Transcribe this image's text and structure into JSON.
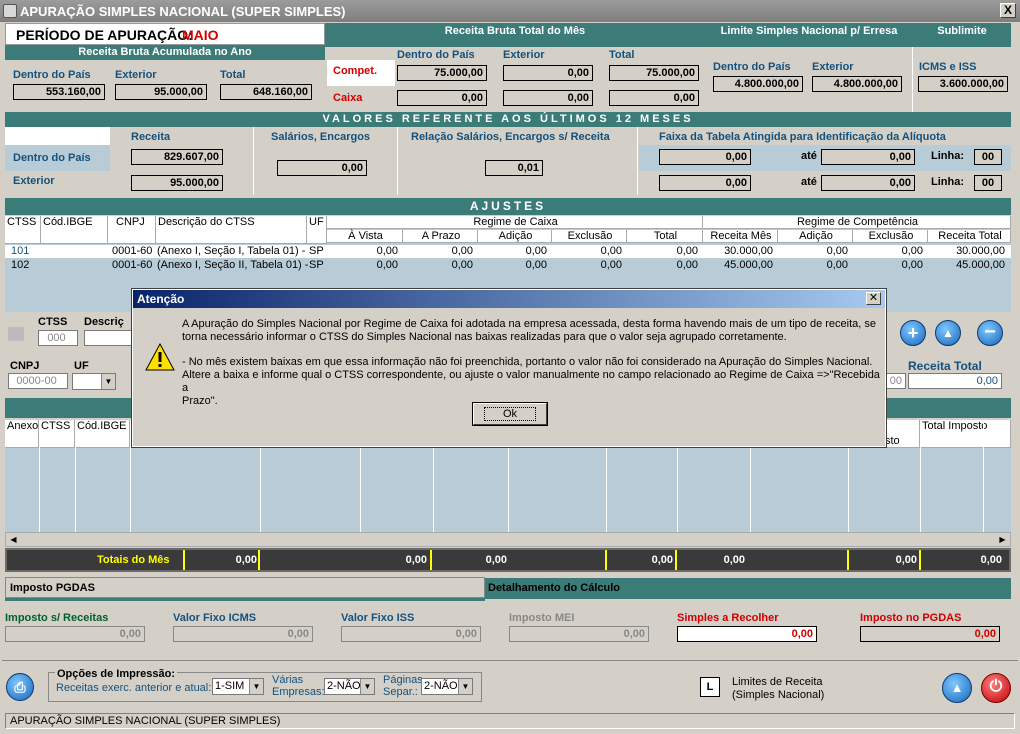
{
  "window": {
    "title": "APURAÇÃO SIMPLES NACIONAL (SUPER SIMPLES)",
    "close": "X"
  },
  "periodo": {
    "label": "PERÍODO DE APURAÇÃO:",
    "value": "MAIO"
  },
  "acumulada": {
    "header": "Receita Bruta Acumulada no Ano",
    "dentro_label": "Dentro do País",
    "exterior_label": "Exterior",
    "total_label": "Total",
    "dentro": "553.160,00",
    "exterior": "95.000,00",
    "total": "648.160,00"
  },
  "mes": {
    "header": "Receita Bruta Total do Mês",
    "col_dentro": "Dentro do País",
    "col_exterior": "Exterior",
    "col_total": "Total",
    "compet_label": "Compet.",
    "caixa_label": "Caixa",
    "compet": [
      "75.000,00",
      "0,00",
      "75.000,00"
    ],
    "caixa": [
      "0,00",
      "0,00",
      "0,00"
    ]
  },
  "limite": {
    "header": "Limite Simples Nacional p/ Erresa",
    "dentro_label": "Dentro do País",
    "exterior_label": "Exterior",
    "dentro": "4.800.000,00",
    "exterior": "4.800.000,00"
  },
  "sublimite": {
    "header": "Sublimite",
    "label": "ICMS e ISS",
    "value": "3.600.000,00"
  },
  "ultimos": {
    "header": "VALORES REFERENTE AOS ÚLTIMOS 12 MESES",
    "receita_label": "Receita",
    "salarios_label": "Salários, Encargos",
    "relacao_label": "Relação Salários, Encargos s/ Receita",
    "faixa_label": "Faixa da Tabela Atingida para Identificação da Alíquota",
    "dentro_label": "Dentro do País",
    "exterior_label": "Exterior",
    "receita_dentro": "829.607,00",
    "receita_exterior": "95.000,00",
    "salarios": "0,00",
    "relacao": "0,01",
    "ate": "até",
    "linha": "Linha:",
    "faixa1_de": "0,00",
    "faixa1_ate": "0,00",
    "faixa1_linha": "00",
    "faixa2_de": "0,00",
    "faixa2_ate": "0,00",
    "faixa2_linha": "00"
  },
  "ajustes": {
    "header": "AJUSTES",
    "cols": [
      "CTSS",
      "Cód.IBGE",
      "CNPJ",
      "Descrição do CTSS",
      "UF"
    ],
    "caixa_group": "Regime de Caixa",
    "comp_group": "Regime de Competência",
    "caixa_cols": [
      "À Vista",
      "A Prazo",
      "Adição",
      "Exclusão",
      "Total"
    ],
    "comp_cols": [
      "Receita Mês",
      "Adição",
      "Exclusão",
      "Receita Total"
    ],
    "rows": [
      {
        "ctss": "101",
        "ibge": "",
        "cnpj": "0001-60",
        "desc": "(Anexo I, Seção I, Tabela 01) -",
        "uf": "SP",
        "v": [
          "0,00",
          "0,00",
          "0,00",
          "0,00",
          "0,00",
          "30.000,00",
          "0,00",
          "0,00",
          "30.000,00"
        ]
      },
      {
        "ctss": "102",
        "ibge": "",
        "cnpj": "0001-60",
        "desc": "(Anexo I, Seção II, Tabela 01) -",
        "uf": "SP",
        "v": [
          "0,00",
          "0,00",
          "0,00",
          "0,00",
          "0,00",
          "45.000,00",
          "0,00",
          "0,00",
          "45.000,00"
        ]
      }
    ]
  },
  "edit": {
    "ctss_label": "CTSS",
    "ctss_value": "000",
    "desc_label": "Descriç",
    "cnpj_label": "CNPJ",
    "cnpj_placeholder": "0000-00",
    "uf_label": "UF",
    "receita_total_label": "Receita Total",
    "receita_total": "0,00",
    "partial_value": "00"
  },
  "calc": {
    "cols": [
      "Anexo",
      "CTSS",
      "Cód.IBGE"
    ],
    "total_imposto": "Total Imposto",
    "partial_col": "sto",
    "totais_label": "Totais do Mês",
    "totais": [
      "0,00",
      "0,00",
      "0,00",
      "0,00",
      "0,00",
      "0,00",
      "0,00"
    ]
  },
  "tabs": {
    "pgdas": "Imposto PGDAS",
    "detalhe": "Detalhamento do Cálculo"
  },
  "bottom": {
    "imposto_receitas": "Imposto s/ Receitas",
    "fixo_icms": "Valor Fixo ICMS",
    "fixo_iss": "Valor Fixo ISS",
    "mei": "Imposto MEI",
    "simples": "Simples a Recolher",
    "pgdas": "Imposto no PGDAS",
    "values": [
      "0,00",
      "0,00",
      "0,00",
      "0,00",
      "0,00",
      "0,00"
    ]
  },
  "print": {
    "label": "Opções de Impressão:",
    "receitas_label": "Receitas exerc. anterior e atual:",
    "receitas_value": "1-SIM",
    "varias_label1": "Várias",
    "varias_label2": "Empresas:",
    "varias_value": "2-NÃO",
    "paginas_label1": "Páginas",
    "paginas_label2": "Separ.:",
    "paginas_value": "2-NÃO"
  },
  "limites": {
    "key": "L",
    "line1": "Limites de Receita",
    "line2": "(Simples Nacional)"
  },
  "status": "APURAÇÃO SIMPLES NACIONAL (SUPER SIMPLES)",
  "dialog": {
    "title": "Atenção",
    "line1": "A Apuração do Simples Nacional por Regime de Caixa foi adotada na empresa acessada, desta forma  havendo mais de um tipo de receita, se",
    "line2": "torna necessário informar o CTSS do Simples Nacional nas baixas realizadas para que o valor seja agrupado corretamente.",
    "line3": " - No mês existem baixas em que essa informação não foi preenchida, portanto o valor não foi  considerado na Apuração do Simples Nacional.",
    "line4": "Altere a baixa e informe qual o CTSS correspondente, ou ajuste o valor manualmente no campo relacionado ao Regime de Caixa =>\"Recebida a",
    "line5": "Prazo\".",
    "ok": "Ok"
  }
}
